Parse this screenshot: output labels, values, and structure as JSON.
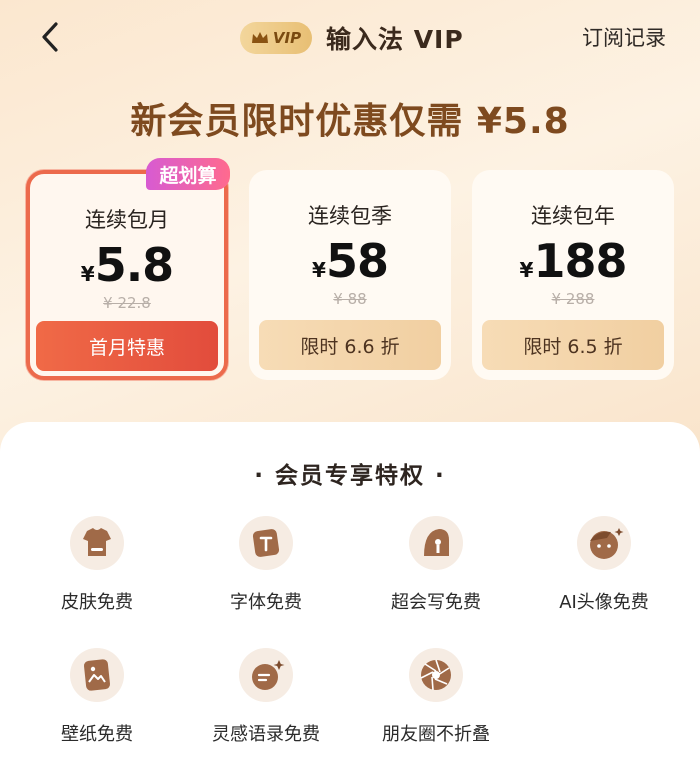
{
  "header": {
    "back_icon": "chevron-left-icon",
    "vip_badge": "VIP",
    "title": "输入法 VIP",
    "subscription_link": "订阅记录"
  },
  "promo": "新会员限时优惠仅需 ¥5.8",
  "plans": [
    {
      "name": "连续包月",
      "currency": "¥",
      "price": "5.8",
      "original": "¥ 22.8",
      "button": "首月特惠",
      "badge": "超划算",
      "selected": true
    },
    {
      "name": "连续包季",
      "currency": "¥",
      "price": "58",
      "original": "¥ 88",
      "button": "限时 6.6 折",
      "selected": false
    },
    {
      "name": "连续包年",
      "currency": "¥",
      "price": "188",
      "original": "¥ 288",
      "button": "限时 6.5 折",
      "selected": false
    }
  ],
  "benefits": {
    "title": "· 会员专享特权 ·",
    "items": [
      {
        "label": "皮肤免费",
        "icon": "tshirt-icon"
      },
      {
        "label": "字体免费",
        "icon": "font-icon"
      },
      {
        "label": "超会写免费",
        "icon": "writing-icon"
      },
      {
        "label": "AI头像免费",
        "icon": "avatar-face-icon"
      },
      {
        "label": "壁纸免费",
        "icon": "wallpaper-icon"
      },
      {
        "label": "灵感语录免费",
        "icon": "inspiration-quote-icon"
      },
      {
        "label": "朋友圈不折叠",
        "icon": "aperture-icon"
      }
    ]
  },
  "colors": {
    "accent": "#7e4a1f",
    "selected_border": "#ec6a4c",
    "badge": "#d75bd2"
  }
}
